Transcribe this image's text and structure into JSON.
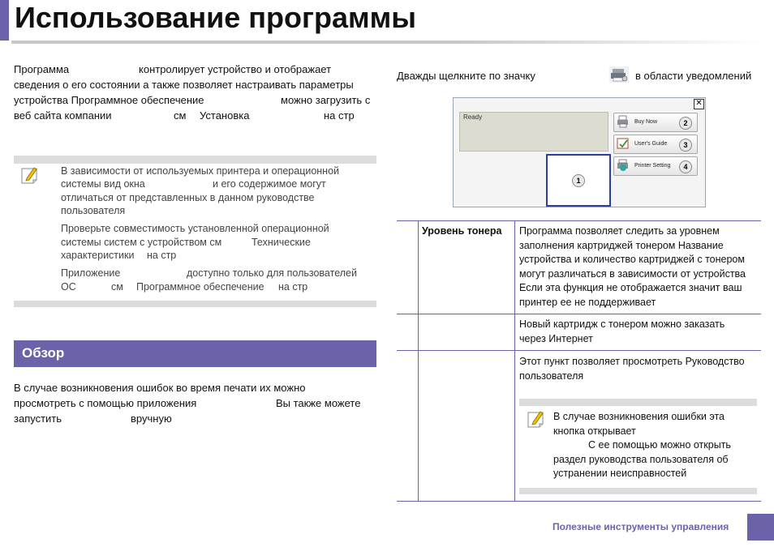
{
  "header": {
    "title": "Использование программы"
  },
  "intro": {
    "line1_a": "Программа",
    "line1_b": "контролирует устройство и отображает",
    "line2": "сведения о его состоянии  а также позволяет настраивать параметры",
    "line3_a": "устройства  Программное обеспечение",
    "line3_b": "можно загрузить с",
    "line4_a": "веб сайта компании",
    "line4_b": "см",
    "line4_c": "Установка",
    "line4_d": "на стр"
  },
  "note": {
    "p1_l1": "В зависимости от используемых принтера и операционной",
    "p1_l2_a": "системы вид окна",
    "p1_l2_b": "и его содержимое могут",
    "p1_l3": "отличаться от представленных в данном руководстве",
    "p1_l4": "пользователя",
    "p2_l1": "Проверьте совместимость установленной операционной",
    "p2_l2_a": "системы  систем  с устройством  см",
    "p2_l2_b": "Технические",
    "p2_l3_a": "характеристики",
    "p2_l3_b": "на стр",
    "p3_l1_a": "Приложение",
    "p3_l1_b": "доступно только для пользователей",
    "p3_l2_a": "ОС",
    "p3_l2_b": "см",
    "p3_l2_c": "Программное обеспечение",
    "p3_l2_d": "на стр"
  },
  "section": {
    "title": "Обзор"
  },
  "overview": {
    "l1": "В случае возникновения ошибок во время печати их можно",
    "l2_a": "просмотреть с помощью приложения",
    "l2_b": "Вы также можете",
    "l3_a": "запустить",
    "l3_b": "вручную"
  },
  "right": {
    "instr_a": "Дважды щелкните по значку",
    "instr_b": "в области уведомлений"
  },
  "window": {
    "status": "Ready",
    "close": "✕",
    "toner_num": "1",
    "buttons": [
      {
        "label": "Buy Now",
        "num": "2"
      },
      {
        "label": "User's Guide",
        "num": "3"
      },
      {
        "label": "Printer Setting",
        "num": "4"
      }
    ]
  },
  "table": {
    "row1_label": "Уровень тонера",
    "row1_l1": "Программа позволяет следить за уровнем",
    "row1_l2": "заполнения картриджей тонером  Название",
    "row1_l3": "устройства и количество картриджей с тонером",
    "row1_l4": "могут различаться в зависимости от устройства",
    "row1_l5": "Если эта функция не отображается  значит ваш",
    "row1_l6": "принтер ее не поддерживает",
    "row2_l1": "Новый картридж с тонером можно заказать",
    "row2_l2": "через Интернет",
    "row3_l1": "Этот пункт позволяет просмотреть Руководство",
    "row3_l2": "пользователя",
    "row3_note_l1": "В случае возникновения ошибки эта",
    "row3_note_l2": "кнопка открывает",
    "row3_note_l3": "С ее помощью можно открыть",
    "row3_note_l4": "раздел руководства пользователя об",
    "row3_note_l5": "устранении неисправностей"
  },
  "footer": {
    "text": "Полезные инструменты управления"
  },
  "colors": {
    "accent": "#6b63aa",
    "note_bar": "#dcdcdc"
  },
  "icons": {
    "note": "pencil-note-icon",
    "tray": "printer-tray-icon"
  }
}
